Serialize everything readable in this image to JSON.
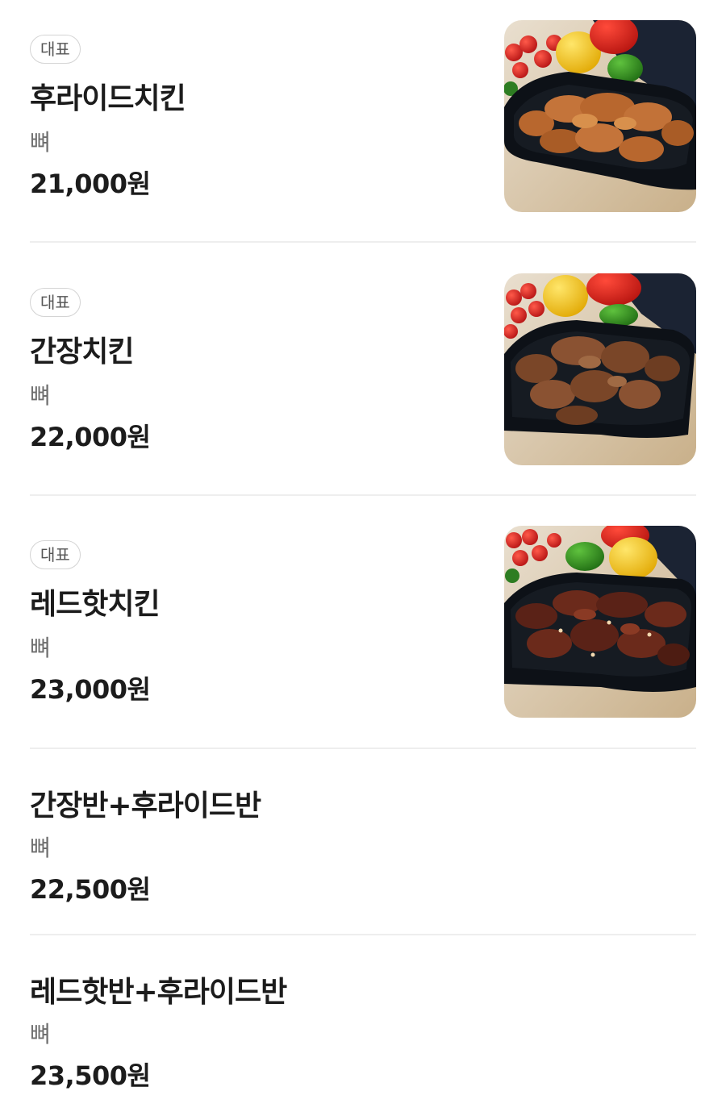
{
  "menu": {
    "items": [
      {
        "badge": "대표",
        "name": "후라이드치킨",
        "desc": "뼈",
        "price": "21,000원",
        "image": "fried-chicken-photo",
        "chicken_color": "#b8672e"
      },
      {
        "badge": "대표",
        "name": "간장치킨",
        "desc": "뼈",
        "price": "22,000원",
        "image": "soy-chicken-photo",
        "chicken_color": "#7a4628"
      },
      {
        "badge": "대표",
        "name": "레드핫치킨",
        "desc": "뼈",
        "price": "23,000원",
        "image": "redhot-chicken-photo",
        "chicken_color": "#5a2217"
      },
      {
        "name": "간장반+후라이드반",
        "desc": "뼈",
        "price": "22,500원"
      },
      {
        "name": "레드핫반+후라이드반",
        "desc": "뼈",
        "price": "23,500원"
      }
    ]
  }
}
